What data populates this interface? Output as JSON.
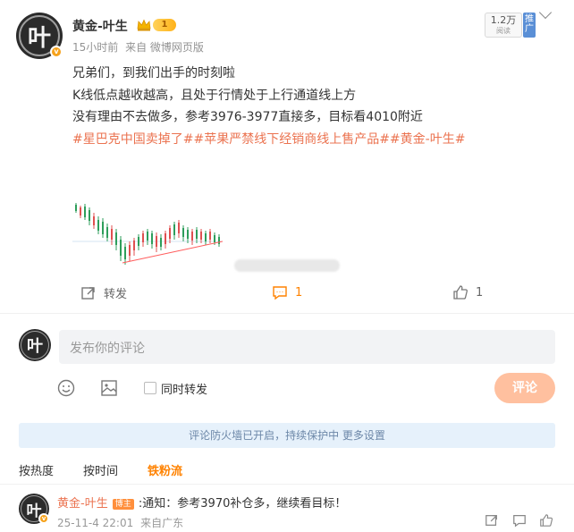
{
  "post": {
    "author": {
      "name": "黄金-叶生",
      "avatar_glyph": "叶",
      "verified_mark": "v",
      "level": "1"
    },
    "meta": {
      "time": "15小时前",
      "source": "来自 微博网页版"
    },
    "views": {
      "count": "1.2万",
      "label": "阅读"
    },
    "push_label": "推广",
    "lines": [
      "兄弟们，到我们出手的时刻啦",
      "K线低点越收越高，且处于行情处于上行通道线上方",
      "没有理由不去做多，参考3976-3977直接多，目标看4010附近"
    ],
    "topics": "#星巴克中国卖掉了##苹果严禁线下经销商线上售产品##黄金-叶生#",
    "actions": {
      "repost_label": "转发",
      "comment_count": "1",
      "like_count": "1"
    }
  },
  "composer": {
    "placeholder": "发布你的评论",
    "also_repost_label": "同时转发",
    "submit_label": "评论"
  },
  "notice": "评论防火墙已开启，持续保护中 更多设置",
  "sort_tabs": [
    "按热度",
    "按时间",
    "铁粉流"
  ],
  "active_sort": "铁粉流",
  "comments": [
    {
      "user": "黄金-叶生",
      "badge": "博主",
      "text": ":通知：参考3970补仓多，继续看目标！",
      "time": "25-11-4 22:01",
      "source": "来自广东"
    }
  ],
  "icons": {
    "repost": "share-icon",
    "comment": "comment-icon",
    "like": "thumbs-up-icon",
    "emoji": "emoji-icon",
    "image": "image-icon",
    "more": "chevron-down-icon"
  },
  "colors": {
    "accent": "#ff8200",
    "topic": "#eb7350",
    "submit_disabled": "#ffc09f",
    "notice_bg": "#e6f1fb"
  }
}
